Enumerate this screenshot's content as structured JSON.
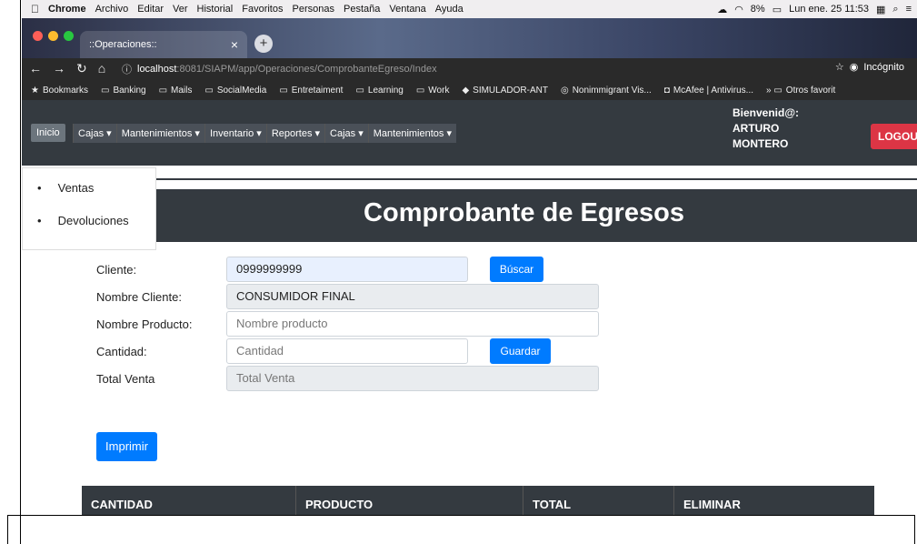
{
  "macbar": {
    "app": "Chrome",
    "menus": [
      "Archivo",
      "Editar",
      "Ver",
      "Historial",
      "Favoritos",
      "Personas",
      "Pestaña",
      "Ventana",
      "Ayuda"
    ],
    "battery": "8%",
    "clock": "Lun ene. 25  11:53"
  },
  "browser": {
    "tab_title": "::Operaciones::",
    "url_host": "localhost",
    "url_path": ":8081/SIAPM/app/Operaciones/ComprobanteEgreso/Index",
    "incognito_label": "Incógnito"
  },
  "bookmarks": [
    "Bookmarks",
    "Banking",
    "Mails",
    "SocialMedia",
    "Entretaiment",
    "Learning",
    "Work",
    "SIMULADOR-ANT",
    "Nonimmigrant Vis...",
    "McAfee | Antivirus...",
    "Otros favorit"
  ],
  "appnav": {
    "home": "Inicio",
    "menus": [
      "Cajas ▾",
      "Mantenimientos ▾",
      "Inventario ▾",
      "Reportes ▾",
      "Cajas ▾",
      "Mantenimientos ▾"
    ],
    "welcome_line1": "Bienvenid@:",
    "welcome_line2": "ARTURO",
    "welcome_line3": "MONTERO",
    "logout": "LOGOU"
  },
  "dropdown": [
    "Ventas",
    "Devoluciones"
  ],
  "page": {
    "title": "Comprobante de Egresos"
  },
  "form": {
    "cliente_label": "Cliente:",
    "cliente_value": "0999999999",
    "buscar": "Búscar",
    "nombre_cliente_label": "Nombre Cliente:",
    "nombre_cliente_value": "CONSUMIDOR FINAL",
    "nombre_producto_label": "Nombre Producto:",
    "nombre_producto_placeholder": "Nombre producto",
    "cantidad_label": "Cantidad:",
    "cantidad_placeholder": "Cantidad",
    "guardar": "Guardar",
    "total_label": "Total Venta",
    "total_placeholder": "Total Venta",
    "imprimir": "Imprimir"
  },
  "table": {
    "headers": [
      "CANTIDAD",
      "PRODUCTO",
      "TOTAL",
      "ELIMINAR"
    ]
  }
}
